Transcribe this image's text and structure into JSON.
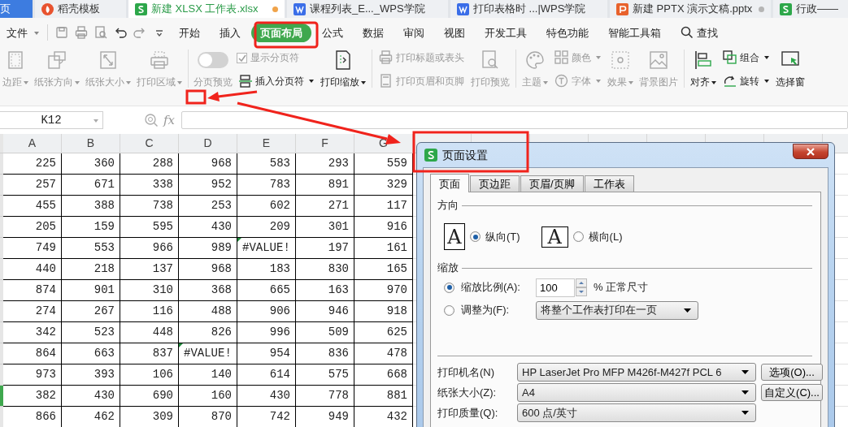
{
  "tabs": [
    {
      "label": "页",
      "kind": "home",
      "selected": false,
      "modified": false
    },
    {
      "label": "稻壳模板",
      "kind": "docer",
      "selected": false,
      "modified": false
    },
    {
      "label": "新建 XLSX 工作表.xlsx",
      "kind": "sheet",
      "selected": true,
      "modified": true
    },
    {
      "label": "课程列表_E..._WPS学院",
      "kind": "writer",
      "selected": false,
      "modified": false
    },
    {
      "label": "打印表格时 ...|WPS学院",
      "kind": "writer",
      "selected": false,
      "modified": false
    },
    {
      "label": "新建 PPTX 演示文稿.pptx",
      "kind": "slides",
      "selected": false,
      "modified": true
    },
    {
      "label": "行政——",
      "kind": "sheet",
      "selected": false,
      "modified": false
    }
  ],
  "menu": {
    "file": "文件",
    "search": "查找",
    "tabs": [
      {
        "label": "开始",
        "selected": false
      },
      {
        "label": "插入",
        "selected": false
      },
      {
        "label": "页面布局",
        "selected": true
      },
      {
        "label": "公式",
        "selected": false
      },
      {
        "label": "数据",
        "selected": false
      },
      {
        "label": "审阅",
        "selected": false
      },
      {
        "label": "视图",
        "selected": false
      },
      {
        "label": "开发工具",
        "selected": false
      },
      {
        "label": "特色功能",
        "selected": false
      },
      {
        "label": "智能工具箱",
        "selected": false
      }
    ]
  },
  "ribbon": {
    "groups": [
      {
        "items": [
          {
            "kind": "large",
            "label": "边距",
            "dropdown": true,
            "disabled": true
          },
          {
            "kind": "large",
            "label": "纸张方向",
            "dropdown": true,
            "disabled": true
          },
          {
            "kind": "large",
            "label": "纸张大小",
            "dropdown": true,
            "disabled": true
          },
          {
            "kind": "large",
            "label": "打印区域",
            "dropdown": true,
            "disabled": true
          }
        ]
      },
      {
        "items": [
          {
            "kind": "toggle",
            "label": "分页预览",
            "on": false,
            "disabled": true
          },
          {
            "kind": "stack",
            "items": [
              {
                "kind": "checkbox",
                "label": "显示分页符",
                "checked": true,
                "disabled": true
              },
              {
                "kind": "small",
                "label": "插入分页符",
                "dropdown": true,
                "disabled": false
              }
            ]
          },
          {
            "kind": "large",
            "label": "打印缩放",
            "dropdown": true,
            "disabled": false
          }
        ]
      },
      {
        "items": [
          {
            "kind": "stack",
            "items": [
              {
                "kind": "small",
                "label": "打印标题或表头",
                "dropdown": false,
                "disabled": true
              },
              {
                "kind": "small",
                "label": "打印页眉和页脚",
                "dropdown": false,
                "disabled": true
              }
            ]
          },
          {
            "kind": "large",
            "label": "打印预览",
            "dropdown": false,
            "disabled": true
          }
        ]
      },
      {
        "items": [
          {
            "kind": "large",
            "label": "主题",
            "dropdown": true,
            "disabled": true
          },
          {
            "kind": "stack",
            "items": [
              {
                "kind": "small",
                "label": "颜色",
                "dropdown": true,
                "disabled": true
              },
              {
                "kind": "small",
                "label": "字体",
                "dropdown": true,
                "disabled": true
              }
            ]
          },
          {
            "kind": "large",
            "label": "效果",
            "dropdown": true,
            "disabled": true
          },
          {
            "kind": "large",
            "label": "背景图片",
            "dropdown": false,
            "disabled": true
          }
        ]
      },
      {
        "items": [
          {
            "kind": "large",
            "label": "对齐",
            "dropdown": true,
            "disabled": false
          },
          {
            "kind": "stack",
            "items": [
              {
                "kind": "small",
                "label": "组合",
                "dropdown": true,
                "disabled": false
              },
              {
                "kind": "small",
                "label": "旋转",
                "dropdown": true,
                "disabled": false
              }
            ]
          },
          {
            "kind": "large",
            "label": "选择窗",
            "dropdown": false,
            "disabled": false
          }
        ]
      }
    ]
  },
  "formula_bar": {
    "name_box": "K12",
    "fx": "fx"
  },
  "sheet": {
    "columns": [
      "A",
      "B",
      "C",
      "D",
      "E",
      "F",
      "G"
    ],
    "rows": [
      {
        "selected": false,
        "cells": [
          "225",
          "360",
          "288",
          "968",
          "583",
          "293",
          "559"
        ]
      },
      {
        "selected": false,
        "cells": [
          "257",
          "671",
          "338",
          "952",
          "783",
          "891",
          "329"
        ]
      },
      {
        "selected": false,
        "cells": [
          "455",
          "388",
          "738",
          "253",
          "602",
          "271",
          "117"
        ]
      },
      {
        "selected": false,
        "cells": [
          "205",
          "159",
          "595",
          "430",
          "209",
          "301",
          "916"
        ]
      },
      {
        "selected": false,
        "cells": [
          "749",
          "553",
          "966",
          "989",
          {
            "text": "#VALUE!",
            "error": true
          },
          "197",
          "161"
        ]
      },
      {
        "selected": false,
        "cells": [
          "440",
          "218",
          "137",
          "968",
          "183",
          "830",
          "165"
        ]
      },
      {
        "selected": false,
        "cells": [
          "874",
          "901",
          "310",
          "368",
          "665",
          "163",
          "970"
        ]
      },
      {
        "selected": false,
        "cells": [
          "274",
          "267",
          "116",
          "488",
          "906",
          "946",
          "918"
        ]
      },
      {
        "selected": false,
        "cells": [
          "342",
          "523",
          "448",
          "826",
          "996",
          "509",
          "625"
        ]
      },
      {
        "selected": false,
        "cells": [
          "864",
          "663",
          "837",
          {
            "text": "#VALUE!",
            "error": true
          },
          "954",
          "836",
          "478"
        ]
      },
      {
        "selected": false,
        "cells": [
          "973",
          "393",
          "106",
          "140",
          "614",
          "575",
          "668"
        ]
      },
      {
        "selected": true,
        "cells": [
          "382",
          "430",
          "690",
          "160",
          "430",
          "778",
          "881"
        ]
      },
      {
        "selected": false,
        "cells": [
          "866",
          "462",
          "309",
          "870",
          "742",
          "949",
          "432"
        ]
      }
    ]
  },
  "dialog": {
    "title": "页面设置",
    "tabs": [
      {
        "label": "页面",
        "selected": true
      },
      {
        "label": "页边距",
        "selected": false
      },
      {
        "label": "页眉/页脚",
        "selected": false
      },
      {
        "label": "工作表",
        "selected": false
      }
    ],
    "orientation": {
      "legend": "方向",
      "options": [
        {
          "kind": "portrait",
          "glyph": "A",
          "label": "纵向(T)",
          "selected": true
        },
        {
          "kind": "landscape",
          "glyph": "A",
          "label": "横向(L)",
          "selected": false
        }
      ]
    },
    "scaling": {
      "legend": "缩放",
      "options": [
        {
          "kind": "percent",
          "label": "缩放比例(A):",
          "selected": true,
          "value": "100",
          "suffix": "% 正常尺寸"
        },
        {
          "kind": "fit",
          "label": "调整为(F):",
          "selected": false,
          "value": "将整个工作表打印在一页"
        }
      ]
    },
    "printer": [
      {
        "label": "打印机名(N)",
        "value": "HP LaserJet Pro MFP M426f-M427f PCL 6",
        "button": "选项(O)..."
      },
      {
        "label": "纸张大小(Z):",
        "value": "A4",
        "button": "自定义(C)..."
      },
      {
        "label": "打印质量(Q):",
        "value": "600 点/英寸"
      }
    ]
  }
}
